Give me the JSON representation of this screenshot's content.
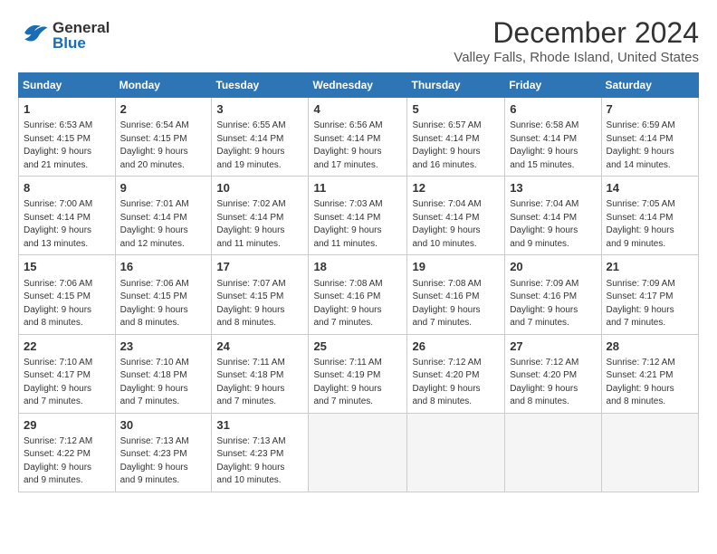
{
  "header": {
    "logo_general": "General",
    "logo_blue": "Blue",
    "title": "December 2024",
    "subtitle": "Valley Falls, Rhode Island, United States"
  },
  "calendar": {
    "headers": [
      "Sunday",
      "Monday",
      "Tuesday",
      "Wednesday",
      "Thursday",
      "Friday",
      "Saturday"
    ],
    "weeks": [
      [
        {
          "day": "1",
          "info": "Sunrise: 6:53 AM\nSunset: 4:15 PM\nDaylight: 9 hours\nand 21 minutes."
        },
        {
          "day": "2",
          "info": "Sunrise: 6:54 AM\nSunset: 4:15 PM\nDaylight: 9 hours\nand 20 minutes."
        },
        {
          "day": "3",
          "info": "Sunrise: 6:55 AM\nSunset: 4:14 PM\nDaylight: 9 hours\nand 19 minutes."
        },
        {
          "day": "4",
          "info": "Sunrise: 6:56 AM\nSunset: 4:14 PM\nDaylight: 9 hours\nand 17 minutes."
        },
        {
          "day": "5",
          "info": "Sunrise: 6:57 AM\nSunset: 4:14 PM\nDaylight: 9 hours\nand 16 minutes."
        },
        {
          "day": "6",
          "info": "Sunrise: 6:58 AM\nSunset: 4:14 PM\nDaylight: 9 hours\nand 15 minutes."
        },
        {
          "day": "7",
          "info": "Sunrise: 6:59 AM\nSunset: 4:14 PM\nDaylight: 9 hours\nand 14 minutes."
        }
      ],
      [
        {
          "day": "8",
          "info": "Sunrise: 7:00 AM\nSunset: 4:14 PM\nDaylight: 9 hours\nand 13 minutes."
        },
        {
          "day": "9",
          "info": "Sunrise: 7:01 AM\nSunset: 4:14 PM\nDaylight: 9 hours\nand 12 minutes."
        },
        {
          "day": "10",
          "info": "Sunrise: 7:02 AM\nSunset: 4:14 PM\nDaylight: 9 hours\nand 11 minutes."
        },
        {
          "day": "11",
          "info": "Sunrise: 7:03 AM\nSunset: 4:14 PM\nDaylight: 9 hours\nand 11 minutes."
        },
        {
          "day": "12",
          "info": "Sunrise: 7:04 AM\nSunset: 4:14 PM\nDaylight: 9 hours\nand 10 minutes."
        },
        {
          "day": "13",
          "info": "Sunrise: 7:04 AM\nSunset: 4:14 PM\nDaylight: 9 hours\nand 9 minutes."
        },
        {
          "day": "14",
          "info": "Sunrise: 7:05 AM\nSunset: 4:14 PM\nDaylight: 9 hours\nand 9 minutes."
        }
      ],
      [
        {
          "day": "15",
          "info": "Sunrise: 7:06 AM\nSunset: 4:15 PM\nDaylight: 9 hours\nand 8 minutes."
        },
        {
          "day": "16",
          "info": "Sunrise: 7:06 AM\nSunset: 4:15 PM\nDaylight: 9 hours\nand 8 minutes."
        },
        {
          "day": "17",
          "info": "Sunrise: 7:07 AM\nSunset: 4:15 PM\nDaylight: 9 hours\nand 8 minutes."
        },
        {
          "day": "18",
          "info": "Sunrise: 7:08 AM\nSunset: 4:16 PM\nDaylight: 9 hours\nand 7 minutes."
        },
        {
          "day": "19",
          "info": "Sunrise: 7:08 AM\nSunset: 4:16 PM\nDaylight: 9 hours\nand 7 minutes."
        },
        {
          "day": "20",
          "info": "Sunrise: 7:09 AM\nSunset: 4:16 PM\nDaylight: 9 hours\nand 7 minutes."
        },
        {
          "day": "21",
          "info": "Sunrise: 7:09 AM\nSunset: 4:17 PM\nDaylight: 9 hours\nand 7 minutes."
        }
      ],
      [
        {
          "day": "22",
          "info": "Sunrise: 7:10 AM\nSunset: 4:17 PM\nDaylight: 9 hours\nand 7 minutes."
        },
        {
          "day": "23",
          "info": "Sunrise: 7:10 AM\nSunset: 4:18 PM\nDaylight: 9 hours\nand 7 minutes."
        },
        {
          "day": "24",
          "info": "Sunrise: 7:11 AM\nSunset: 4:18 PM\nDaylight: 9 hours\nand 7 minutes."
        },
        {
          "day": "25",
          "info": "Sunrise: 7:11 AM\nSunset: 4:19 PM\nDaylight: 9 hours\nand 7 minutes."
        },
        {
          "day": "26",
          "info": "Sunrise: 7:12 AM\nSunset: 4:20 PM\nDaylight: 9 hours\nand 8 minutes."
        },
        {
          "day": "27",
          "info": "Sunrise: 7:12 AM\nSunset: 4:20 PM\nDaylight: 9 hours\nand 8 minutes."
        },
        {
          "day": "28",
          "info": "Sunrise: 7:12 AM\nSunset: 4:21 PM\nDaylight: 9 hours\nand 8 minutes."
        }
      ],
      [
        {
          "day": "29",
          "info": "Sunrise: 7:12 AM\nSunset: 4:22 PM\nDaylight: 9 hours\nand 9 minutes."
        },
        {
          "day": "30",
          "info": "Sunrise: 7:13 AM\nSunset: 4:23 PM\nDaylight: 9 hours\nand 9 minutes."
        },
        {
          "day": "31",
          "info": "Sunrise: 7:13 AM\nSunset: 4:23 PM\nDaylight: 9 hours\nand 10 minutes."
        },
        {
          "day": "",
          "info": ""
        },
        {
          "day": "",
          "info": ""
        },
        {
          "day": "",
          "info": ""
        },
        {
          "day": "",
          "info": ""
        }
      ]
    ]
  }
}
